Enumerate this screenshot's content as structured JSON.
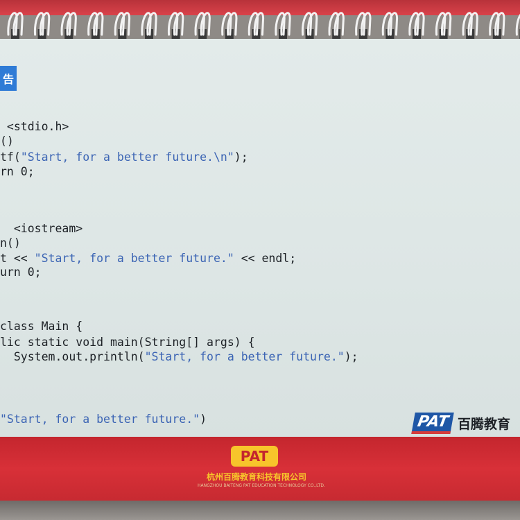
{
  "tab_label": "告",
  "code_lines": {
    "l1": " <stdio.h>",
    "l2": "()",
    "l3_pre": "tf(",
    "l3_str": "\"Start, for a better future.\\n\"",
    "l3_post": ");",
    "l4": "rn 0;",
    "l5": "  <iostream>",
    "l6": "n()",
    "l7_pre": "t << ",
    "l7_str": "\"Start, for a better future.\"",
    "l7_post": " << endl;",
    "l8": "urn 0;",
    "l9": "class Main {",
    "l10": "lic static void main(String[] args) {",
    "l11_pre": "  System.out.println(",
    "l11_str": "\"Start, for a better future.\"",
    "l11_post": ");",
    "l12_str": "\"Start, for a better future.\"",
    "l12_post": ")"
  },
  "brand": {
    "logo": "PAT",
    "name": "百腾教育"
  },
  "base": {
    "logo": "PAT",
    "company_cn": "杭州百腾教育科技有限公司",
    "company_en": "HANGZHOU BAITENG PAT EDUCATION TECHNOLOGY CO.,LTD."
  },
  "colors": {
    "code_string": "#3b64b4",
    "base_red": "#d83038",
    "tab_blue": "#2f7bd6"
  }
}
